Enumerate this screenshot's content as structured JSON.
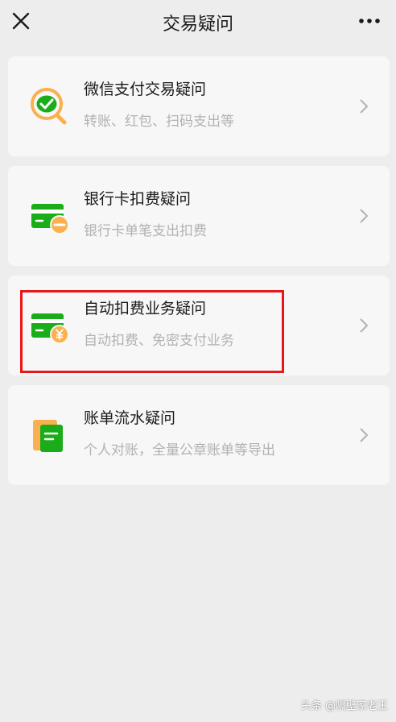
{
  "header": {
    "title": "交易疑问",
    "close_icon": "close-icon",
    "more_icon": "more-dots-icon"
  },
  "items": [
    {
      "title": "微信支付交易疑问",
      "subtitle": "转账、红包、扫码支出等",
      "icon": "wechat-pay-search-icon"
    },
    {
      "title": "银行卡扣费疑问",
      "subtitle": "银行卡单笔支出扣费",
      "icon": "bank-card-minus-icon"
    },
    {
      "title": "自动扣费业务疑问",
      "subtitle": "自动扣费、免密支付业务",
      "icon": "bank-card-yuan-icon"
    },
    {
      "title": "账单流水疑问",
      "subtitle": "个人对账，全量公章账单等导出",
      "icon": "bill-document-icon"
    }
  ],
  "colors": {
    "background": "#ededed",
    "card": "#f7f7f7",
    "green": "#1aad19",
    "orange": "#fab04e",
    "highlight": "#e8171a"
  },
  "watermark": "头条 @隔壁家老王"
}
